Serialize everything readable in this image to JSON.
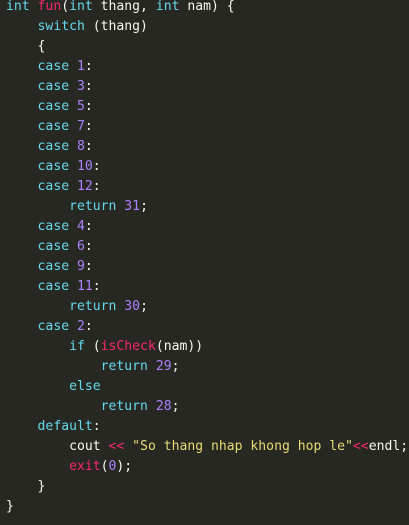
{
  "code_lines": [
    {
      "indent": "",
      "tokens": [
        [
          "kw-type",
          "int"
        ],
        [
          "plain",
          " "
        ],
        [
          "fn",
          "fun"
        ],
        [
          "plain",
          "("
        ],
        [
          "kw-type",
          "int"
        ],
        [
          "plain",
          " thang, "
        ],
        [
          "kw-type",
          "int"
        ],
        [
          "plain",
          " nam) {"
        ]
      ]
    },
    {
      "indent": "    ",
      "tokens": [
        [
          "kw",
          "switch"
        ],
        [
          "plain",
          " (thang)"
        ]
      ]
    },
    {
      "indent": "    ",
      "tokens": [
        [
          "plain",
          "{"
        ]
      ]
    },
    {
      "indent": "    ",
      "tokens": [
        [
          "kw",
          "case"
        ],
        [
          "plain",
          " "
        ],
        [
          "num",
          "1"
        ],
        [
          "plain",
          ":"
        ]
      ]
    },
    {
      "indent": "    ",
      "tokens": [
        [
          "kw",
          "case"
        ],
        [
          "plain",
          " "
        ],
        [
          "num",
          "3"
        ],
        [
          "plain",
          ":"
        ]
      ]
    },
    {
      "indent": "    ",
      "tokens": [
        [
          "kw",
          "case"
        ],
        [
          "plain",
          " "
        ],
        [
          "num",
          "5"
        ],
        [
          "plain",
          ":"
        ]
      ]
    },
    {
      "indent": "    ",
      "tokens": [
        [
          "kw",
          "case"
        ],
        [
          "plain",
          " "
        ],
        [
          "num",
          "7"
        ],
        [
          "plain",
          ":"
        ]
      ]
    },
    {
      "indent": "    ",
      "tokens": [
        [
          "kw",
          "case"
        ],
        [
          "plain",
          " "
        ],
        [
          "num",
          "8"
        ],
        [
          "plain",
          ":"
        ]
      ]
    },
    {
      "indent": "    ",
      "tokens": [
        [
          "kw",
          "case"
        ],
        [
          "plain",
          " "
        ],
        [
          "num",
          "10"
        ],
        [
          "plain",
          ":"
        ]
      ]
    },
    {
      "indent": "    ",
      "tokens": [
        [
          "kw",
          "case"
        ],
        [
          "plain",
          " "
        ],
        [
          "num",
          "12"
        ],
        [
          "plain",
          ":"
        ]
      ]
    },
    {
      "indent": "        ",
      "tokens": [
        [
          "kw",
          "return"
        ],
        [
          "plain",
          " "
        ],
        [
          "num",
          "31"
        ],
        [
          "plain",
          ";"
        ]
      ]
    },
    {
      "indent": "    ",
      "tokens": [
        [
          "kw",
          "case"
        ],
        [
          "plain",
          " "
        ],
        [
          "num",
          "4"
        ],
        [
          "plain",
          ":"
        ]
      ]
    },
    {
      "indent": "    ",
      "tokens": [
        [
          "kw",
          "case"
        ],
        [
          "plain",
          " "
        ],
        [
          "num",
          "6"
        ],
        [
          "plain",
          ":"
        ]
      ]
    },
    {
      "indent": "    ",
      "tokens": [
        [
          "kw",
          "case"
        ],
        [
          "plain",
          " "
        ],
        [
          "num",
          "9"
        ],
        [
          "plain",
          ":"
        ]
      ]
    },
    {
      "indent": "    ",
      "tokens": [
        [
          "kw",
          "case"
        ],
        [
          "plain",
          " "
        ],
        [
          "num",
          "11"
        ],
        [
          "plain",
          ":"
        ]
      ]
    },
    {
      "indent": "        ",
      "tokens": [
        [
          "kw",
          "return"
        ],
        [
          "plain",
          " "
        ],
        [
          "num",
          "30"
        ],
        [
          "plain",
          ";"
        ]
      ]
    },
    {
      "indent": "    ",
      "tokens": [
        [
          "kw",
          "case"
        ],
        [
          "plain",
          " "
        ],
        [
          "num",
          "2"
        ],
        [
          "plain",
          ":"
        ]
      ]
    },
    {
      "indent": "        ",
      "tokens": [
        [
          "kw",
          "if"
        ],
        [
          "plain",
          " ("
        ],
        [
          "fn",
          "isCheck"
        ],
        [
          "plain",
          "(nam))"
        ]
      ]
    },
    {
      "indent": "            ",
      "tokens": [
        [
          "kw",
          "return"
        ],
        [
          "plain",
          " "
        ],
        [
          "num",
          "29"
        ],
        [
          "plain",
          ";"
        ]
      ]
    },
    {
      "indent": "        ",
      "tokens": [
        [
          "kw",
          "else"
        ]
      ]
    },
    {
      "indent": "            ",
      "tokens": [
        [
          "kw",
          "return"
        ],
        [
          "plain",
          " "
        ],
        [
          "num",
          "28"
        ],
        [
          "plain",
          ";"
        ]
      ]
    },
    {
      "indent": "    ",
      "tokens": [
        [
          "kw",
          "default"
        ],
        [
          "plain",
          ":"
        ]
      ]
    },
    {
      "indent": "        ",
      "tokens": [
        [
          "plain",
          "cout "
        ],
        [
          "op",
          "<<"
        ],
        [
          "plain",
          " "
        ],
        [
          "str",
          "\"So thang nhap khong hop le\""
        ],
        [
          "op",
          "<<"
        ],
        [
          "plain",
          "endl;"
        ]
      ]
    },
    {
      "indent": "        ",
      "tokens": [
        [
          "fn",
          "exit"
        ],
        [
          "plain",
          "("
        ],
        [
          "num",
          "0"
        ],
        [
          "plain",
          ");"
        ]
      ]
    },
    {
      "indent": "    ",
      "tokens": [
        [
          "plain",
          "}"
        ]
      ]
    },
    {
      "indent": "",
      "tokens": [
        [
          "plain",
          "}"
        ]
      ]
    }
  ],
  "colors": {
    "background": "#272822",
    "keyword": "#66d9ef",
    "function": "#f92672",
    "number": "#ae81ff",
    "string": "#e6db74",
    "operator": "#f92672",
    "text": "#f8f8f2"
  }
}
